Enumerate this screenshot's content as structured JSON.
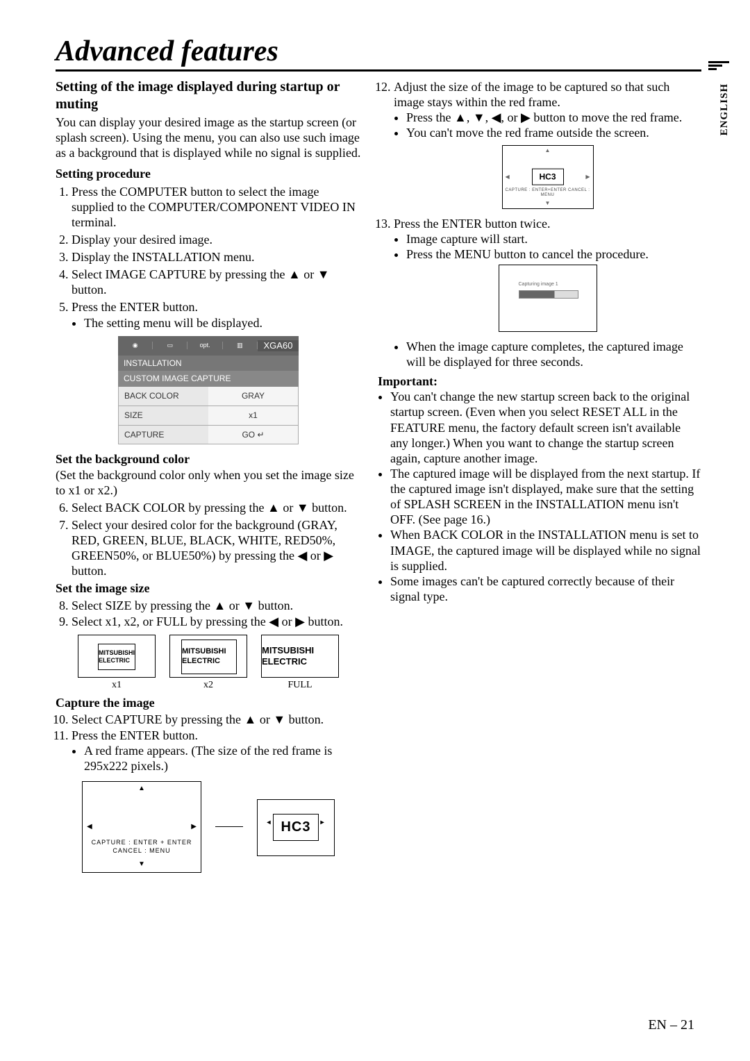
{
  "title": "Advanced features",
  "side_label": "ENGLISH",
  "page_number": "EN – 21",
  "left": {
    "heading": "Setting of the image displayed during startup or muting",
    "intro": "You can display your desired image as the startup screen (or splash screen). Using the menu, you can also use such image as a background that is displayed while no signal is supplied.",
    "setting_procedure_title": "Setting procedure",
    "step1": "Press the COMPUTER button to select the image supplied to the COMPUTER/COMPONENT VIDEO IN terminal.",
    "step2": "Display your desired image.",
    "step3": "Display the INSTALLATION menu.",
    "step4_a": "Select IMAGE CAPTURE by pressing the ",
    "step4_b": " or ",
    "step4_c": " button.",
    "step5": "Press the ENTER button.",
    "step5_sub": "The setting menu will be displayed.",
    "menu": {
      "xga": "XGA60",
      "install": "INSTALLATION",
      "custom": "CUSTOM IMAGE CAPTURE",
      "rows": [
        {
          "k": "BACK COLOR",
          "v": "GRAY"
        },
        {
          "k": "SIZE",
          "v": "x1"
        },
        {
          "k": "CAPTURE",
          "v": "GO ↵"
        }
      ]
    },
    "bg_title": "Set the background color",
    "bg_note": "(Set the background color only when you set the image size to x1 or x2.)",
    "step6_a": "Select BACK COLOR by pressing the ",
    "step6_b": " or ",
    "step6_c": " button.",
    "step7_a": "Select your desired color for the background (GRAY, RED, GREEN, BLUE, BLACK, WHITE, RED50%, GREEN50%, or  BLUE50%) by pressing the ",
    "step7_b": " or ",
    "step7_c": " button.",
    "size_title": "Set the image size",
    "step8_a": "Select SIZE by pressing the ",
    "step8_b": " or ",
    "step8_c": " button.",
    "step9_a": "Select x1, x2, or FULL by pressing the ",
    "step9_b": " or ",
    "step9_c": " button.",
    "tiles": {
      "x1": "x1",
      "x2": "x2",
      "full": "FULL",
      "logo": "MITSUBISHI ELECTRIC"
    },
    "cap_title": "Capture the image",
    "step10_a": "Select CAPTURE by pressing the ",
    "step10_b": " or ",
    "step10_c": " button.",
    "step11": "Press the ENTER button.",
    "step11_sub": "A red frame appears.  (The size of the red frame is 295x222 pixels.)",
    "capture_box_line1": "CAPTURE : ENTER + ENTER",
    "capture_box_line2": "CANCEL : MENU",
    "hc3": "HC3"
  },
  "right": {
    "step12": "Adjust the size of the image to be captured so that such image stays within the red frame.",
    "step12_s1a": "Press the ",
    "step12_s1b": ", ",
    "step12_s1c": ", ",
    "step12_s1d": ", or ",
    "step12_s1e": " button to move the red frame.",
    "step12_s2": "You can't move the red frame outside the screen.",
    "mini_hc3": "HC3",
    "mini_sub": "CAPTURE : ENTER+ENTER   CANCEL : MENU",
    "step13": "Press the ENTER button twice.",
    "step13_s1": "Image capture will start.",
    "step13_s2": "Press the MENU button to cancel the procedure.",
    "mini2_label": "Capturing image 1",
    "step13_s3": "When the image capture completes, the captured image will be displayed for three seconds.",
    "important": "Important:",
    "imp1": "You can't change the new startup screen back to the original startup screen.  (Even when you select RESET ALL in the FEATURE menu, the factory default screen isn't available any longer.)  When you want to change the startup screen again, capture another image.",
    "imp2": "The captured image will be displayed from the next startup.  If the captured image isn't displayed, make sure that the setting of SPLASH SCREEN in the INSTALLATION menu isn't OFF. (See page 16.)",
    "imp3": "When BACK COLOR in the INSTALLATION menu is set to IMAGE, the captured image will be displayed while no signal is supplied.",
    "imp4": "Some images can't be captured correctly because of their signal type."
  },
  "arrows": {
    "up": "▲",
    "down": "▼",
    "left": "◀",
    "right": "▶"
  }
}
